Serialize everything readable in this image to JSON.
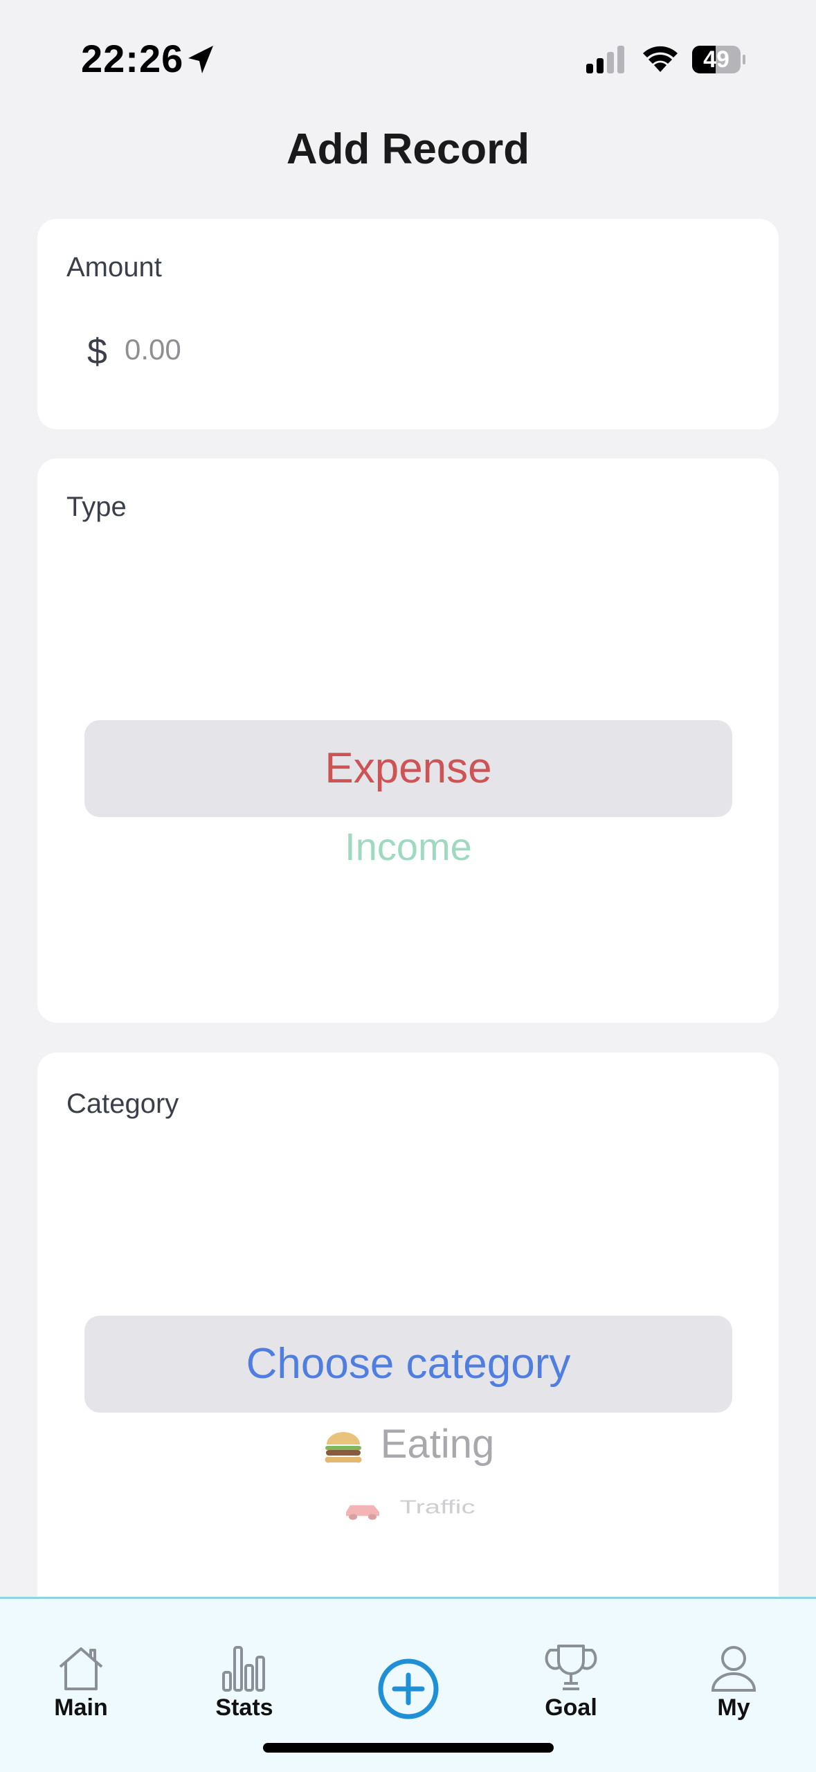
{
  "status_bar": {
    "time": "22:26",
    "battery_level": "49"
  },
  "page": {
    "title": "Add Record"
  },
  "amount": {
    "label": "Amount",
    "currency_symbol": "$",
    "placeholder": "0.00",
    "value": ""
  },
  "type": {
    "label": "Type",
    "selected": "Expense",
    "options": [
      "Expense",
      "Income"
    ],
    "colors": {
      "expense": "#cd5354",
      "income": "#9fd9c0"
    }
  },
  "category": {
    "label": "Category",
    "selected": "Choose category",
    "options": [
      {
        "label": "Eating",
        "icon": "burger-icon"
      },
      {
        "label": "Traffic",
        "icon": "car-icon"
      }
    ]
  },
  "tab_bar": {
    "tabs": [
      {
        "label": "Main",
        "icon": "home-icon"
      },
      {
        "label": "Stats",
        "icon": "bar-chart-icon"
      },
      {
        "label": "",
        "icon": "plus-circle-icon"
      },
      {
        "label": "Goal",
        "icon": "trophy-icon"
      },
      {
        "label": "My",
        "icon": "person-icon"
      }
    ],
    "accent_color": "#1f8fd6"
  }
}
